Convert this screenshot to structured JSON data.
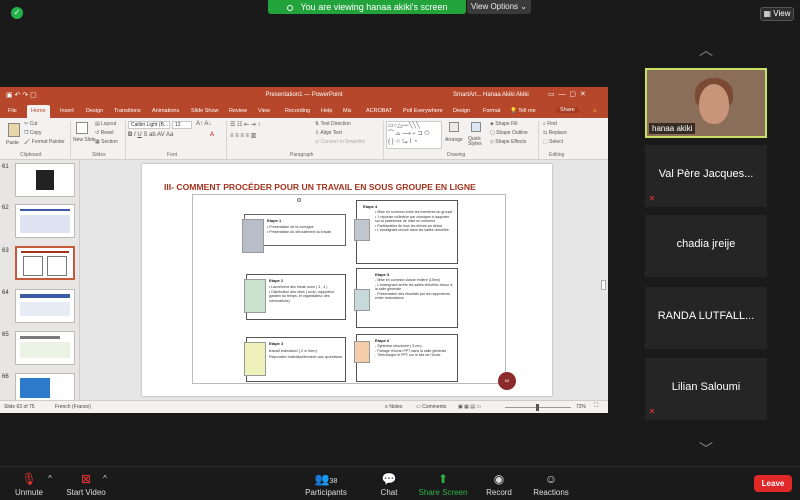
{
  "zoom": {
    "share_banner": "You are viewing hanaa akiki's screen",
    "view_options": "View Options ⌄",
    "view_button": "View"
  },
  "ppt": {
    "window_title": "Presentation1 — PowerPoint",
    "title_right": "SmartArt...",
    "user": "Hanaa Akiki Akiki",
    "tabs": [
      "File",
      "Home",
      "Insert",
      "Design",
      "Transitions",
      "Animations",
      "Slide Show",
      "Review",
      "View",
      "Recording",
      "Help",
      "Mix",
      "ACROBAT",
      "Poll Everywhere",
      "Design",
      "Format"
    ],
    "tell_me": "Tell me",
    "share": "Share",
    "ribbon": {
      "paste": "Paste",
      "cut": "Cut",
      "copy": "Copy",
      "format_painter": "Format Painter",
      "clipboard": "Clipboard",
      "new_slide": "New Slide",
      "layout": "Layout",
      "reset": "Reset",
      "section": "Section",
      "slides": "Slides",
      "font_name": "Calibri Light (B...",
      "font_size": "12",
      "font": "Font",
      "text_direction": "Text Direction",
      "align_text": "Align Text",
      "convert_smartart": "Convert to SmartArt",
      "paragraph": "Paragraph",
      "arrange": "Arrange",
      "quick_styles": "Quick Styles",
      "shape_fill": "Shape Fill",
      "shape_outline": "Shape Outline",
      "shape_effects": "Shape Effects",
      "drawing": "Drawing",
      "find": "Find",
      "replace": "Replace",
      "select": "Select",
      "editing": "Editing"
    },
    "thumb_numbers": [
      "61",
      "62",
      "63",
      "64",
      "65",
      "66"
    ],
    "slide": {
      "title": "III- COMMENT PROCÉDER POUR UN TRAVAIL EN SOUS GROUPE EN LIGNE",
      "page_number": "63",
      "steps": [
        {
          "head": "Etape 1",
          "body": "• Présentation de la consigne\n• Présentation du déroulement du travail"
        },
        {
          "head": "Etape 2",
          "body": "• Lancement des break room ( 3 , 4 )\n• Distribution des rôles ( scrip, rapporteur, gardien du temps, et organisateur des informations)"
        },
        {
          "head": "Etape 3",
          "body": "travail individuel ( 2 à 3mn)\nRépondre individuellement aux questions"
        },
        {
          "head": "Etape 4",
          "body": "• Mise en commun entre les membres du groupe\n• 1 réponse collective par consigne à rapporter sur la plateforme de mise en commun\n• Participation de tous les élèves au débat\n• L'enseignant circule dans les salles virtuelles"
        },
        {
          "head": "Etape 5",
          "body": "- Mise en commun classe entière (15mn)\n- L'enseignant arrête les salles virtuelles retour à la salle générale\n- Présentation des résultats par les rapporteurs éviter redondance"
        },
        {
          "head": "Etape 6",
          "body": "- Synthèse structurée ( 5 mn)\n- Partage d'écran PPT dans la salle générale\n- Télécharger le PPT sur le site de l'école"
        }
      ]
    },
    "status": {
      "slide_of": "Slide 63 of 75",
      "language": "French (France)",
      "notes": "Notes",
      "comments": "Comments",
      "zoom": "72%"
    }
  },
  "participants": [
    {
      "name": "hanaa akiki"
    },
    {
      "name": "Val Père Jacques..."
    },
    {
      "name": "chadia jreije"
    },
    {
      "name": "RANDA LUTFALL..."
    },
    {
      "name": "Lilian Saloumi"
    }
  ],
  "toolbar": {
    "unmute": "Unmute",
    "start_video": "Start Video",
    "participants": "Participants",
    "participants_count": "38",
    "chat": "Chat",
    "share_screen": "Share Screen",
    "record": "Record",
    "reactions": "Reactions",
    "leave": "Leave"
  },
  "colors": {
    "accent": "#b7472a",
    "zoom_green": "#23a33c",
    "leave_red": "#e02828"
  }
}
